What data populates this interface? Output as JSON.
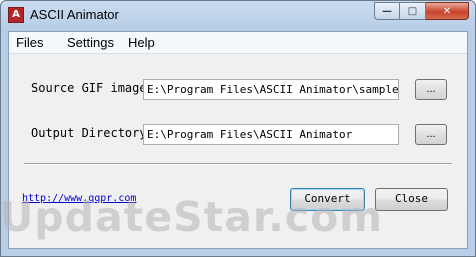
{
  "window": {
    "title": "ASCII Animator",
    "icon_text": "A",
    "minimize_glyph": "—",
    "maximize_glyph": "□",
    "close_glyph": "✕"
  },
  "menu": {
    "items": [
      "Files",
      "Settings",
      "Help"
    ]
  },
  "form": {
    "source_label": "Source GIF image:",
    "source_value": "E:\\Program Files\\ASCII Animator\\sample.gif",
    "output_label": "Output Directory:",
    "output_value": "E:\\Program Files\\ASCII Animator",
    "browse_label": "..."
  },
  "footer": {
    "link_text": "http://www.qqpr.com",
    "convert_label": "Convert",
    "close_label": "Close"
  },
  "watermark": {
    "text": "UpdateStar.com"
  },
  "colors": {
    "link": "#0000cc",
    "close_button": "#c8442d",
    "window_frame": "#b9cfe7"
  }
}
